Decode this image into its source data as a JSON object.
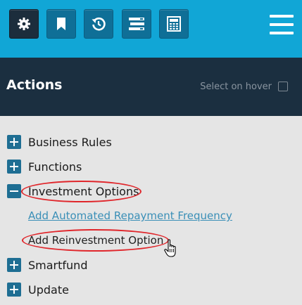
{
  "toolbar": {
    "buttons": [
      {
        "name": "settings",
        "icon": "gear-icon",
        "active": true
      },
      {
        "name": "bookmark",
        "icon": "bookmark-icon",
        "active": false
      },
      {
        "name": "history",
        "icon": "history-icon",
        "active": false
      },
      {
        "name": "list",
        "icon": "list-icon",
        "active": false
      },
      {
        "name": "calculator",
        "icon": "calculator-icon",
        "active": false
      }
    ],
    "menu_icon": "hamburger-menu-icon"
  },
  "header": {
    "title": "Actions",
    "select_on_hover_label": "Select on hover",
    "select_on_hover_checked": false
  },
  "tree": {
    "items": [
      {
        "label": "Business Rules",
        "expanded": false
      },
      {
        "label": "Functions",
        "expanded": false
      },
      {
        "label": "Investment Options",
        "expanded": true,
        "children": [
          {
            "label": "Add Automated Repayment Frequency",
            "style": "link"
          },
          {
            "label": "Add Reinvestment Option",
            "style": "hover"
          }
        ]
      },
      {
        "label": "Smartfund",
        "expanded": false
      },
      {
        "label": "Update",
        "expanded": false
      }
    ]
  },
  "colors": {
    "toolbar_bg": "#11a6d6",
    "button_bg": "#0f6f97",
    "active_button_bg": "#1c2d3c",
    "header_bg": "#1b2f40",
    "panel_bg": "#e5e5e5",
    "toggle_bg": "#1e6e93",
    "link": "#3a8fb7",
    "annotation_red": "#e0262b"
  }
}
